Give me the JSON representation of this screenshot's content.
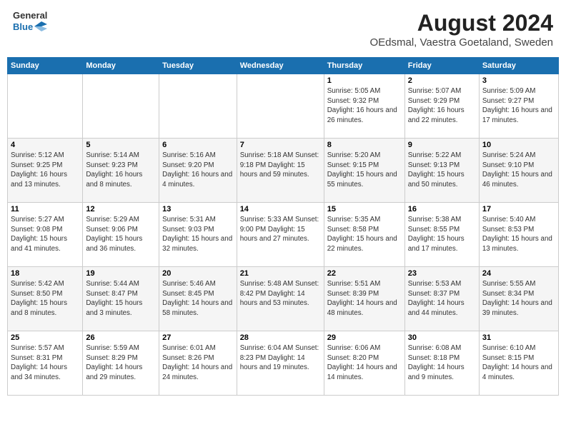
{
  "header": {
    "logo_line1": "General",
    "logo_line2": "Blue",
    "main_title": "August 2024",
    "sub_title": "OEdsmal, Vaestra Goetaland, Sweden"
  },
  "weekdays": [
    "Sunday",
    "Monday",
    "Tuesday",
    "Wednesday",
    "Thursday",
    "Friday",
    "Saturday"
  ],
  "weeks": [
    [
      {
        "day": "",
        "content": ""
      },
      {
        "day": "",
        "content": ""
      },
      {
        "day": "",
        "content": ""
      },
      {
        "day": "",
        "content": ""
      },
      {
        "day": "1",
        "content": "Sunrise: 5:05 AM\nSunset: 9:32 PM\nDaylight: 16 hours\nand 26 minutes."
      },
      {
        "day": "2",
        "content": "Sunrise: 5:07 AM\nSunset: 9:29 PM\nDaylight: 16 hours\nand 22 minutes."
      },
      {
        "day": "3",
        "content": "Sunrise: 5:09 AM\nSunset: 9:27 PM\nDaylight: 16 hours\nand 17 minutes."
      }
    ],
    [
      {
        "day": "4",
        "content": "Sunrise: 5:12 AM\nSunset: 9:25 PM\nDaylight: 16 hours\nand 13 minutes."
      },
      {
        "day": "5",
        "content": "Sunrise: 5:14 AM\nSunset: 9:23 PM\nDaylight: 16 hours\nand 8 minutes."
      },
      {
        "day": "6",
        "content": "Sunrise: 5:16 AM\nSunset: 9:20 PM\nDaylight: 16 hours\nand 4 minutes."
      },
      {
        "day": "7",
        "content": "Sunrise: 5:18 AM\nSunset: 9:18 PM\nDaylight: 15 hours\nand 59 minutes."
      },
      {
        "day": "8",
        "content": "Sunrise: 5:20 AM\nSunset: 9:15 PM\nDaylight: 15 hours\nand 55 minutes."
      },
      {
        "day": "9",
        "content": "Sunrise: 5:22 AM\nSunset: 9:13 PM\nDaylight: 15 hours\nand 50 minutes."
      },
      {
        "day": "10",
        "content": "Sunrise: 5:24 AM\nSunset: 9:10 PM\nDaylight: 15 hours\nand 46 minutes."
      }
    ],
    [
      {
        "day": "11",
        "content": "Sunrise: 5:27 AM\nSunset: 9:08 PM\nDaylight: 15 hours\nand 41 minutes."
      },
      {
        "day": "12",
        "content": "Sunrise: 5:29 AM\nSunset: 9:06 PM\nDaylight: 15 hours\nand 36 minutes."
      },
      {
        "day": "13",
        "content": "Sunrise: 5:31 AM\nSunset: 9:03 PM\nDaylight: 15 hours\nand 32 minutes."
      },
      {
        "day": "14",
        "content": "Sunrise: 5:33 AM\nSunset: 9:00 PM\nDaylight: 15 hours\nand 27 minutes."
      },
      {
        "day": "15",
        "content": "Sunrise: 5:35 AM\nSunset: 8:58 PM\nDaylight: 15 hours\nand 22 minutes."
      },
      {
        "day": "16",
        "content": "Sunrise: 5:38 AM\nSunset: 8:55 PM\nDaylight: 15 hours\nand 17 minutes."
      },
      {
        "day": "17",
        "content": "Sunrise: 5:40 AM\nSunset: 8:53 PM\nDaylight: 15 hours\nand 13 minutes."
      }
    ],
    [
      {
        "day": "18",
        "content": "Sunrise: 5:42 AM\nSunset: 8:50 PM\nDaylight: 15 hours\nand 8 minutes."
      },
      {
        "day": "19",
        "content": "Sunrise: 5:44 AM\nSunset: 8:47 PM\nDaylight: 15 hours\nand 3 minutes."
      },
      {
        "day": "20",
        "content": "Sunrise: 5:46 AM\nSunset: 8:45 PM\nDaylight: 14 hours\nand 58 minutes."
      },
      {
        "day": "21",
        "content": "Sunrise: 5:48 AM\nSunset: 8:42 PM\nDaylight: 14 hours\nand 53 minutes."
      },
      {
        "day": "22",
        "content": "Sunrise: 5:51 AM\nSunset: 8:39 PM\nDaylight: 14 hours\nand 48 minutes."
      },
      {
        "day": "23",
        "content": "Sunrise: 5:53 AM\nSunset: 8:37 PM\nDaylight: 14 hours\nand 44 minutes."
      },
      {
        "day": "24",
        "content": "Sunrise: 5:55 AM\nSunset: 8:34 PM\nDaylight: 14 hours\nand 39 minutes."
      }
    ],
    [
      {
        "day": "25",
        "content": "Sunrise: 5:57 AM\nSunset: 8:31 PM\nDaylight: 14 hours\nand 34 minutes."
      },
      {
        "day": "26",
        "content": "Sunrise: 5:59 AM\nSunset: 8:29 PM\nDaylight: 14 hours\nand 29 minutes."
      },
      {
        "day": "27",
        "content": "Sunrise: 6:01 AM\nSunset: 8:26 PM\nDaylight: 14 hours\nand 24 minutes."
      },
      {
        "day": "28",
        "content": "Sunrise: 6:04 AM\nSunset: 8:23 PM\nDaylight: 14 hours\nand 19 minutes."
      },
      {
        "day": "29",
        "content": "Sunrise: 6:06 AM\nSunset: 8:20 PM\nDaylight: 14 hours\nand 14 minutes."
      },
      {
        "day": "30",
        "content": "Sunrise: 6:08 AM\nSunset: 8:18 PM\nDaylight: 14 hours\nand 9 minutes."
      },
      {
        "day": "31",
        "content": "Sunrise: 6:10 AM\nSunset: 8:15 PM\nDaylight: 14 hours\nand 4 minutes."
      }
    ]
  ]
}
